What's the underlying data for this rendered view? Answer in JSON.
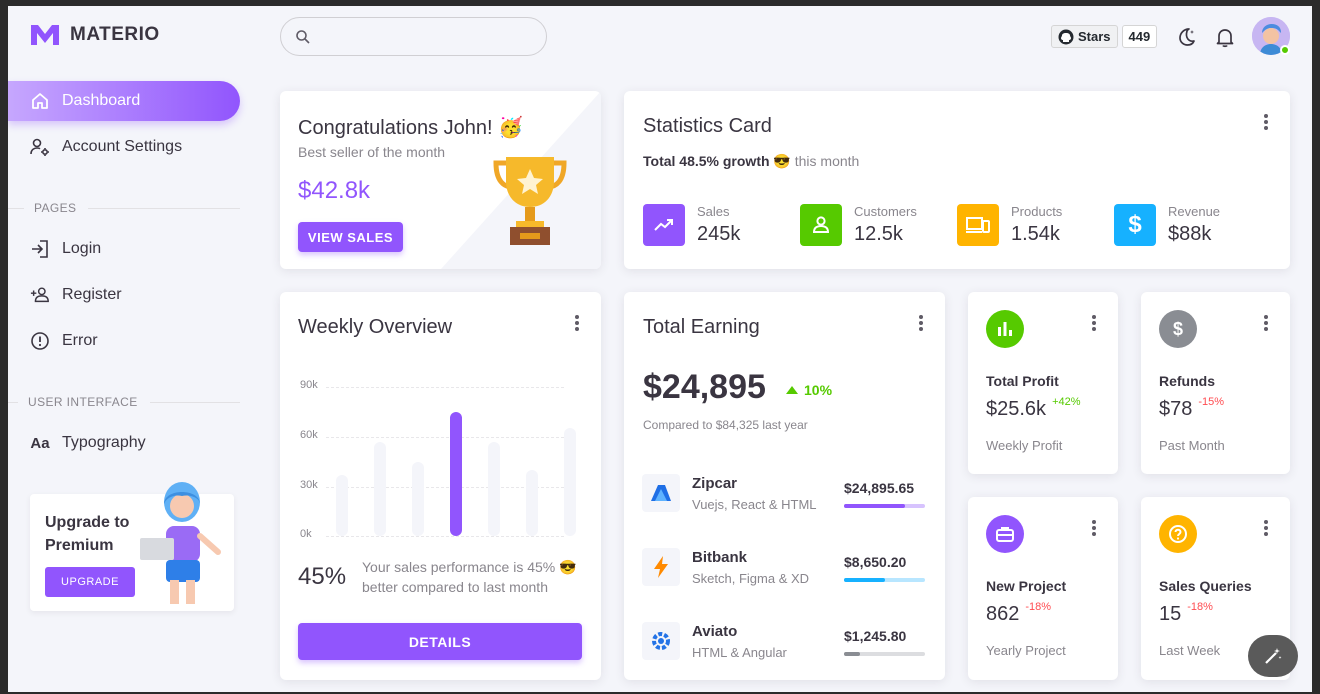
{
  "brand": {
    "name": "MATERIO"
  },
  "sidebar": {
    "items": [
      {
        "label": "Dashboard"
      },
      {
        "label": "Account Settings"
      }
    ],
    "pages_title": "PAGES",
    "pages": [
      {
        "label": "Login"
      },
      {
        "label": "Register"
      },
      {
        "label": "Error"
      }
    ],
    "ui_title": "USER INTERFACE",
    "ui": [
      {
        "label": "Typography"
      }
    ],
    "upgrade": {
      "title": "Upgrade to Premium",
      "button": "UPGRADE"
    }
  },
  "header": {
    "search_placeholder": "",
    "stars_label": "Stars",
    "stars_count": "449"
  },
  "congrats": {
    "title": "Congratulations John! 🥳",
    "subtitle": "Best seller of the month",
    "amount": "$42.8k",
    "button": "VIEW SALES"
  },
  "statistics": {
    "title": "Statistics Card",
    "growth_bold": "Total 48.5% growth 😎",
    "growth_rest": "this month",
    "items": [
      {
        "label": "Sales",
        "value": "245k",
        "color": "#9155fd"
      },
      {
        "label": "Customers",
        "value": "12.5k",
        "color": "#56ca00"
      },
      {
        "label": "Products",
        "value": "1.54k",
        "color": "#ffb400"
      },
      {
        "label": "Revenue",
        "value": "$88k",
        "color": "#16b1ff"
      }
    ]
  },
  "weekly": {
    "title": "Weekly Overview",
    "percent": "45%",
    "description": "Your sales performance is 45% 😎 better compared to last month",
    "button": "DETAILS"
  },
  "chart_data": {
    "type": "bar",
    "categories": [
      "",
      "",
      "",
      "",
      "",
      "",
      ""
    ],
    "values": [
      37,
      57,
      45,
      75,
      57,
      40,
      65
    ],
    "highlight_index": 3,
    "y_ticks": [
      "90k",
      "60k",
      "30k",
      "0k"
    ],
    "ylim": [
      0,
      90
    ]
  },
  "earning": {
    "title": "Total Earning",
    "amount": "$24,895",
    "change": "10%",
    "compare": "Compared to $84,325 last year",
    "rows": [
      {
        "name": "Zipcar",
        "sub": "Vuejs, React & HTML",
        "amount": "$24,895.65",
        "progress": 0.75,
        "color": "#9155fd",
        "track": "#d7c3fe"
      },
      {
        "name": "Bitbank",
        "sub": "Sketch, Figma & XD",
        "amount": "$8,650.20",
        "progress": 0.5,
        "color": "#16b1ff",
        "track": "#b8e6ff"
      },
      {
        "name": "Aviato",
        "sub": "HTML & Angular",
        "amount": "$1,245.80",
        "progress": 0.2,
        "color": "#8a8d93",
        "track": "#dcdde0"
      }
    ]
  },
  "mini": [
    {
      "title": "Total Profit",
      "value": "$25.6k",
      "change": "+42%",
      "change_color": "#56ca00",
      "sub": "Weekly Profit",
      "icon_color": "#56ca00"
    },
    {
      "title": "Refunds",
      "value": "$78",
      "change": "-15%",
      "change_color": "#ff4c51",
      "sub": "Past Month",
      "icon_color": "#8a8d93"
    },
    {
      "title": "New Project",
      "value": "862",
      "change": "-18%",
      "change_color": "#ff4c51",
      "sub": "Yearly Project",
      "icon_color": "#9155fd"
    },
    {
      "title": "Sales Queries",
      "value": "15",
      "change": "-18%",
      "change_color": "#ff4c51",
      "sub": "Last Week",
      "icon_color": "#ffb400"
    }
  ]
}
